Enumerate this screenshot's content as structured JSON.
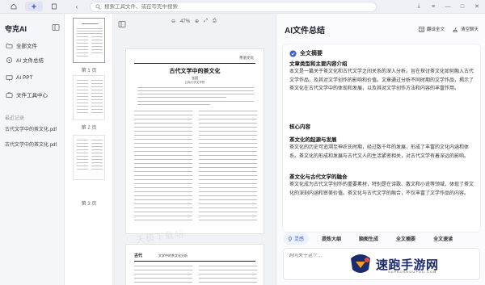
{
  "topbar": {
    "search_placeholder": "搜索工具文件、或在夸克中搜索"
  },
  "sidebar": {
    "brand": "夸克AI",
    "items": [
      {
        "label": "全部文件"
      },
      {
        "label": "AI 文件总结"
      },
      {
        "label": "AI PPT"
      },
      {
        "label": "文件工具中心"
      }
    ],
    "recent_label": "最近记录",
    "recent_files": [
      "古代文学中的茶文化.pdf",
      "古代文学中的茶文化.pdf"
    ]
  },
  "thumbnails": {
    "labels": [
      "第 1 页",
      "第 2 页",
      "第 3 页"
    ]
  },
  "viewer": {
    "zoom": "47%",
    "page1": {
      "running_head": "茶道文化",
      "title": "古代文学中的茶文化",
      "author": "张国",
      "affiliation": "云南大学文学院"
    },
    "page2": {
      "head": "古代",
      "sub": "文学中的茶文化分析"
    },
    "watermark": "天极下载站"
  },
  "ai_panel": {
    "title": "AI文件总结",
    "actions": {
      "translate": "翻译全文",
      "clear": "清空聊天"
    },
    "card_title": "全文摘要",
    "blocks": [
      {
        "heading": "文章类型和主要内容介绍",
        "text": "本文是一篇关于茶文化和古代文学之间关系的深入分析。旨在探讨茶文化如何融入古代文学作品，及其对文学创作的影响和价值。文章通过分析不同时期的文学作品，揭示了茶文化在古代文学中的体现和发展，以及其对文学创作方法和内容的丰富作用。"
      },
      {
        "heading": "核心内容",
        "text": ""
      },
      {
        "heading": "茶文化的起源与发展",
        "text": "茶文化的历史可追溯至神农氏时期，经过数千年的发展，形成了丰富的文化内涵和体系。茶文化的形成和发展与古代文人的生活紧密相关，对古代文学有着深远的影响。"
      },
      {
        "heading": "茶文化与古代文学的融合",
        "text": "茶文化成为古代文学创作的重要素材，特别是在诗歌、散文和小说等领域，体现了茶文化的深刻内涵和审美价值。茶文化与古代文学的融合，不仅丰富了文学作品的内容。"
      }
    ],
    "chips": [
      "灵感",
      "提炼大纲",
      "脑图生成",
      "全文摘要",
      "全文速读"
    ],
    "input_placeholder": "询问关于这个...",
    "brand_watermark": "速跑手游网",
    "brand_watermark_sub": "SUPAOSHOUYOU.COM"
  }
}
